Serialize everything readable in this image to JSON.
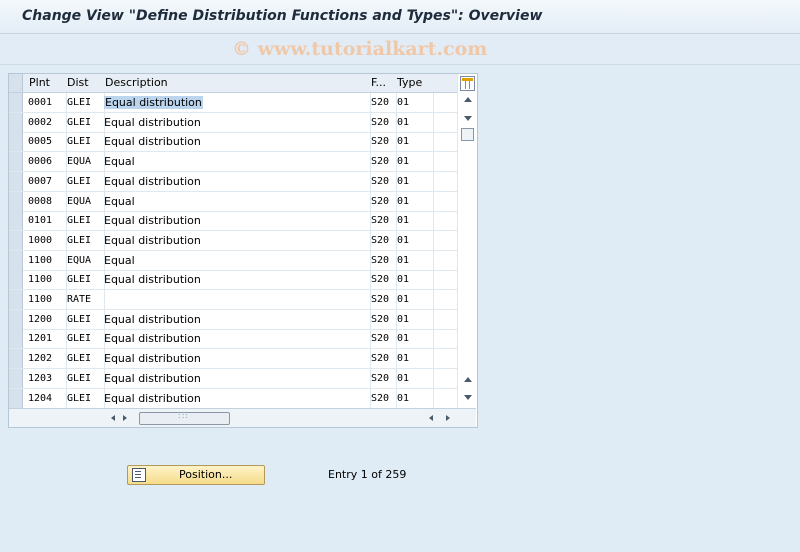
{
  "title": "Change View \"Define Distribution Functions and Types\": Overview",
  "watermark": "© www.tutorialkart.com",
  "table": {
    "columns": [
      "Plnt",
      "Dist",
      "Description",
      "F...",
      "Type"
    ],
    "rows": [
      {
        "plnt": "0001",
        "dist": "GLEI",
        "description": "Equal distribution",
        "f": "S20",
        "type": "01"
      },
      {
        "plnt": "0002",
        "dist": "GLEI",
        "description": "Equal distribution",
        "f": "S20",
        "type": "01"
      },
      {
        "plnt": "0005",
        "dist": "GLEI",
        "description": "Equal distribution",
        "f": "S20",
        "type": "01"
      },
      {
        "plnt": "0006",
        "dist": "EQUA",
        "description": "Equal",
        "f": "S20",
        "type": "01"
      },
      {
        "plnt": "0007",
        "dist": "GLEI",
        "description": "Equal distribution",
        "f": "S20",
        "type": "01"
      },
      {
        "plnt": "0008",
        "dist": "EQUA",
        "description": "Equal",
        "f": "S20",
        "type": "01"
      },
      {
        "plnt": "0101",
        "dist": "GLEI",
        "description": "Equal distribution",
        "f": "S20",
        "type": "01"
      },
      {
        "plnt": "1000",
        "dist": "GLEI",
        "description": "Equal distribution",
        "f": "S20",
        "type": "01"
      },
      {
        "plnt": "1100",
        "dist": "EQUA",
        "description": "Equal",
        "f": "S20",
        "type": "01"
      },
      {
        "plnt": "1100",
        "dist": "GLEI",
        "description": "Equal distribution",
        "f": "S20",
        "type": "01"
      },
      {
        "plnt": "1100",
        "dist": "RATE",
        "description": "",
        "f": "S20",
        "type": "01"
      },
      {
        "plnt": "1200",
        "dist": "GLEI",
        "description": "Equal distribution",
        "f": "S20",
        "type": "01"
      },
      {
        "plnt": "1201",
        "dist": "GLEI",
        "description": "Equal distribution",
        "f": "S20",
        "type": "01"
      },
      {
        "plnt": "1202",
        "dist": "GLEI",
        "description": "Equal distribution",
        "f": "S20",
        "type": "01"
      },
      {
        "plnt": "1203",
        "dist": "GLEI",
        "description": "Equal distribution",
        "f": "S20",
        "type": "01"
      },
      {
        "plnt": "1204",
        "dist": "GLEI",
        "description": "Equal distribution",
        "f": "S20",
        "type": "01"
      }
    ]
  },
  "position_button": "Position...",
  "entry_text": "Entry 1 of 259",
  "colors": {
    "background": "#dfebf5",
    "button": "#f5dc8a",
    "highlight": "#bcd5ee"
  }
}
